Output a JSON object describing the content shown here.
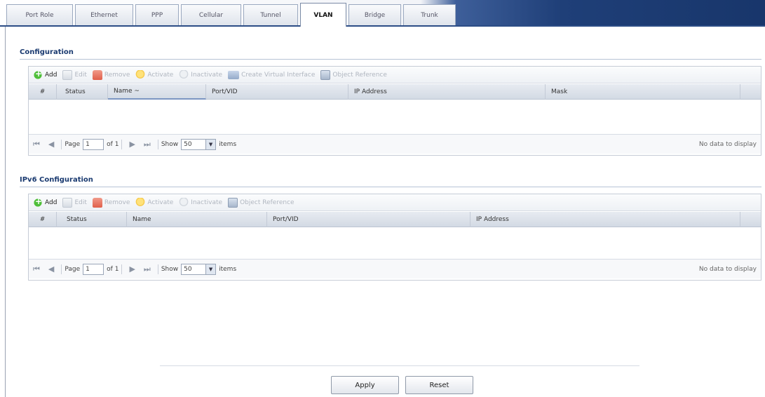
{
  "tabs": [
    {
      "label": "Port Role",
      "active": false
    },
    {
      "label": "Ethernet",
      "active": false
    },
    {
      "label": "PPP",
      "active": false
    },
    {
      "label": "Cellular",
      "active": false
    },
    {
      "label": "Tunnel",
      "active": false
    },
    {
      "label": "VLAN",
      "active": true
    },
    {
      "label": "Bridge",
      "active": false
    },
    {
      "label": "Trunk",
      "active": false
    }
  ],
  "config": {
    "title": "Configuration",
    "toolbar": {
      "add": "Add",
      "edit": "Edit",
      "remove": "Remove",
      "activate": "Activate",
      "inactivate": "Inactivate",
      "create_virtual": "Create Virtual Interface",
      "object_reference": "Object Reference"
    },
    "columns": [
      "#",
      "Status",
      "Name ~",
      "Port/VID",
      "IP Address",
      "Mask"
    ]
  },
  "ipv6": {
    "title": "IPv6 Configuration",
    "toolbar": {
      "add": "Add",
      "edit": "Edit",
      "remove": "Remove",
      "activate": "Activate",
      "inactivate": "Inactivate",
      "object_reference": "Object Reference"
    },
    "columns": [
      "#",
      "Status",
      "Name",
      "Port/VID",
      "IP Address"
    ]
  },
  "pager": {
    "page_label": "Page",
    "page_value": "1",
    "of_label": "of 1",
    "show_label": "Show",
    "show_value": "50",
    "items_label": "items",
    "no_data": "No data to display"
  },
  "buttons": {
    "apply": "Apply",
    "reset": "Reset"
  },
  "colors": {
    "tab_bar_dark": "#1f3f78",
    "section_title": "#1a3a70"
  }
}
